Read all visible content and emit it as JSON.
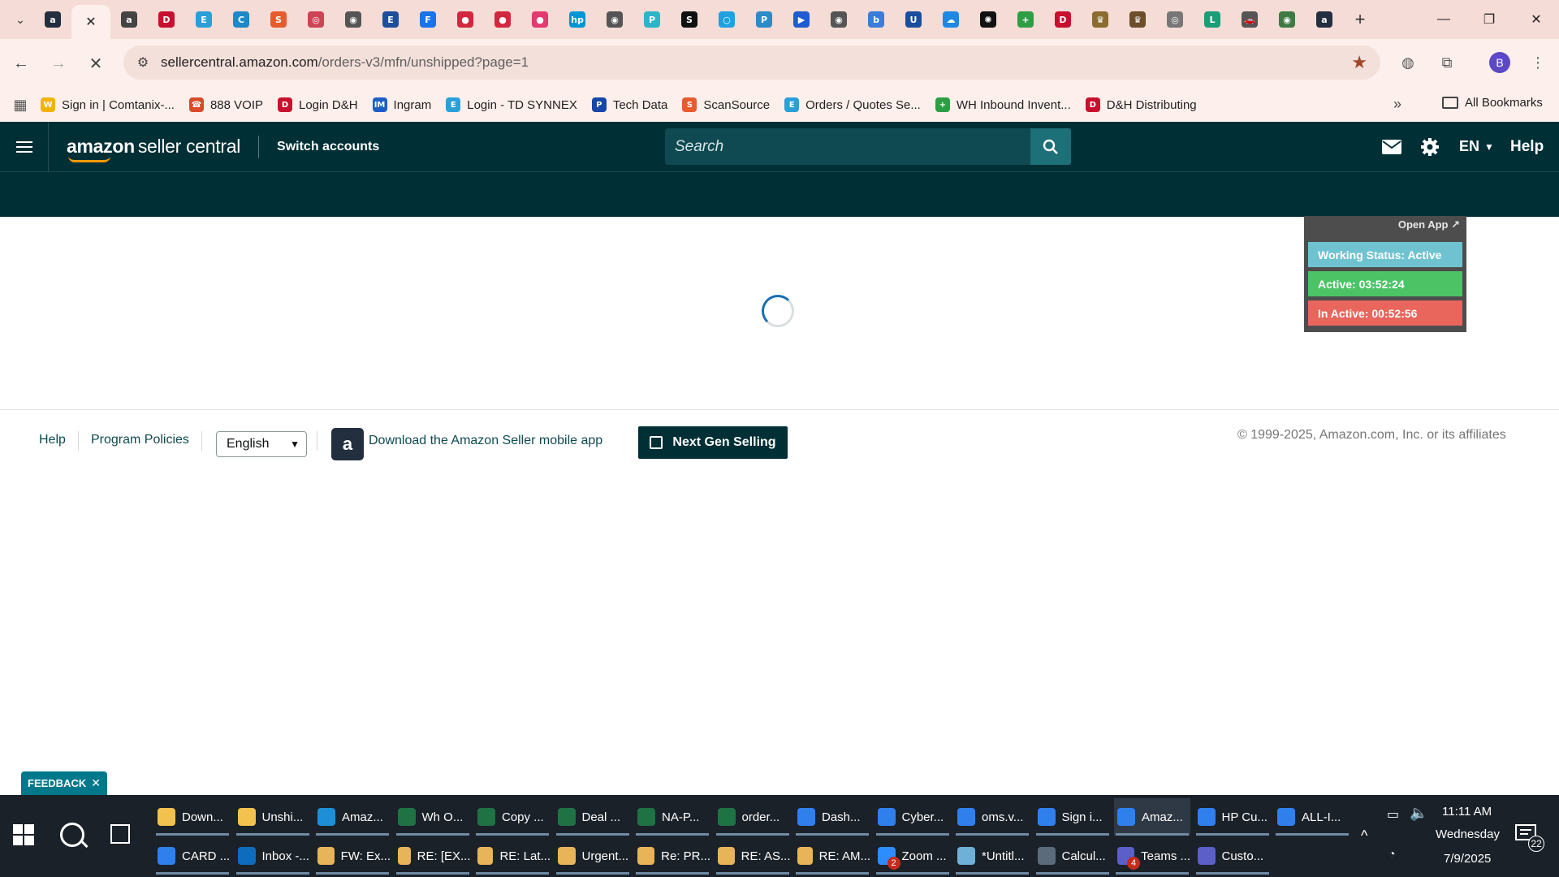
{
  "browser": {
    "tabs": [
      {
        "icon": "amazon-icon",
        "color": "#232f3e",
        "glyph": "a"
      },
      {
        "icon": "loading-tab-icon",
        "active": true
      },
      {
        "icon": "amazon-circle-icon",
        "color": "#444444",
        "glyph": "a"
      },
      {
        "icon": "dh-icon",
        "color": "#c8102e",
        "glyph": "D"
      },
      {
        "icon": "ec-icon",
        "color": "#2a9fd8",
        "glyph": "E"
      },
      {
        "icon": "bookmark-app-icon",
        "color": "#1e88c8",
        "glyph": "C"
      },
      {
        "icon": "scansource-icon",
        "color": "#e65c2e",
        "glyph": "S"
      },
      {
        "icon": "tool-icon",
        "color": "#c45",
        "glyph": "◎"
      },
      {
        "icon": "globe-icon",
        "color": "#555555",
        "glyph": "◉"
      },
      {
        "icon": "etn-icon",
        "color": "#1d4f9c",
        "glyph": "E"
      },
      {
        "icon": "f-icon",
        "color": "#1a73e8",
        "glyph": "F"
      },
      {
        "icon": "red-circle-icon",
        "color": "#d3263f",
        "glyph": "●"
      },
      {
        "icon": "red-circle-icon",
        "color": "#d3263f",
        "glyph": "●"
      },
      {
        "icon": "pink-circle-icon",
        "color": "#e23b6e",
        "glyph": "●"
      },
      {
        "icon": "hp-icon",
        "color": "#0096d6",
        "glyph": "hp"
      },
      {
        "icon": "globe-icon",
        "color": "#555555",
        "glyph": "◉"
      },
      {
        "icon": "p-icon",
        "color": "#2db4c8",
        "glyph": "P"
      },
      {
        "icon": "s-icon",
        "color": "#111111",
        "glyph": "S"
      },
      {
        "icon": "ring-icon",
        "color": "#1ea1e0",
        "glyph": "○"
      },
      {
        "icon": "p-icon",
        "color": "#2d8bc8",
        "glyph": "P"
      },
      {
        "icon": "arrow-icon",
        "color": "#1f5bd1",
        "glyph": "▶"
      },
      {
        "icon": "globe-icon",
        "color": "#555555",
        "glyph": "◉"
      },
      {
        "icon": "b-icon",
        "color": "#3b7dd8",
        "glyph": "b"
      },
      {
        "icon": "u-icon",
        "color": "#1a4fa0",
        "glyph": "U"
      },
      {
        "icon": "cloud-icon",
        "color": "#1e88e5",
        "glyph": "☁"
      },
      {
        "icon": "openai-icon",
        "color": "#111111",
        "glyph": "✺"
      },
      {
        "icon": "plus-green-icon",
        "color": "#2e9e44",
        "glyph": "+"
      },
      {
        "icon": "dh-icon",
        "color": "#c8102e",
        "glyph": "D"
      },
      {
        "icon": "crown-icon",
        "color": "#8a6d2e",
        "glyph": "♛"
      },
      {
        "icon": "crown-icon",
        "color": "#6d4d2a",
        "glyph": "♛"
      },
      {
        "icon": "target-icon",
        "color": "#777777",
        "glyph": "◎"
      },
      {
        "icon": "logi-icon",
        "color": "#1b9e77",
        "glyph": "L"
      },
      {
        "icon": "car-icon",
        "color": "#555555",
        "glyph": "🚗"
      },
      {
        "icon": "green-globe-icon",
        "color": "#3f7a45",
        "glyph": "◉"
      },
      {
        "icon": "amazon-icon",
        "color": "#232f3e",
        "glyph": "a"
      }
    ],
    "url_host": "sellercentral.amazon.com",
    "url_path": "/orders-v3/mfn/unshipped?page=1",
    "profile_initial": "B",
    "bookmarks": [
      {
        "label": "Sign in | Comtanix-...",
        "icon": "w-icon",
        "color": "#f0b400",
        "glyph": "W"
      },
      {
        "label": "888 VOIP",
        "icon": "voip-icon",
        "color": "#d94a2b",
        "glyph": "☎"
      },
      {
        "label": "Login D&H",
        "icon": "dh-icon",
        "color": "#c8102e",
        "glyph": "D"
      },
      {
        "label": "Ingram",
        "icon": "im-icon",
        "color": "#1d5fc1",
        "glyph": "IM"
      },
      {
        "label": "Login - TD SYNNEX",
        "icon": "ec-icon",
        "color": "#2a9fd8",
        "glyph": "E"
      },
      {
        "label": "Tech Data",
        "icon": "tech-data-icon",
        "color": "#1846a8",
        "glyph": "P"
      },
      {
        "label": "ScanSource",
        "icon": "scansource-icon",
        "color": "#e65c2e",
        "glyph": "S"
      },
      {
        "label": "Orders / Quotes Se...",
        "icon": "ec-icon",
        "color": "#2a9fd8",
        "glyph": "E"
      },
      {
        "label": "WH Inbound Invent...",
        "icon": "sheets-icon",
        "color": "#2e9e44",
        "glyph": "+"
      },
      {
        "label": "D&H Distributing",
        "icon": "dh-icon",
        "color": "#c8102e",
        "glyph": "D"
      }
    ],
    "all_bookmarks": "All Bookmarks"
  },
  "seller_central": {
    "logo_amazon": "amazon",
    "logo_rest": "seller central",
    "switch_accounts": "Switch accounts",
    "search_placeholder": "Search",
    "language": "EN",
    "help": "Help"
  },
  "status_widget": {
    "open_app": "Open App ↗",
    "working_status": "Working Status: Active",
    "active": "Active: 03:52:24",
    "inactive": "In Active: 00:52:56",
    "colors": {
      "working": "#6fc3d0",
      "active": "#4cc466",
      "inactive": "#e8665c"
    }
  },
  "footer": {
    "help": "Help",
    "program_policies": "Program Policies",
    "language_select": "English",
    "download_app": "Download the Amazon Seller mobile app",
    "next_gen": "Next Gen Selling",
    "copyright": "© 1999-2025, Amazon.com, Inc. or its affiliates"
  },
  "feedback": "FEEDBACK",
  "taskbar": {
    "row1": [
      {
        "label": "Down...",
        "icon": "folder-icon",
        "color": "#f2c14e"
      },
      {
        "label": "Unshi...",
        "icon": "folder-icon",
        "color": "#f2c14e"
      },
      {
        "label": "Amaz...",
        "icon": "edge-icon",
        "color": "#1d8fd6"
      },
      {
        "label": "Wh O...",
        "icon": "excel-icon",
        "color": "#1f7244"
      },
      {
        "label": "Copy ...",
        "icon": "excel-icon",
        "color": "#1f7244"
      },
      {
        "label": "Deal ...",
        "icon": "excel-icon",
        "color": "#1f7244"
      },
      {
        "label": "NA-P...",
        "icon": "excel-icon",
        "color": "#1f7244"
      },
      {
        "label": "order...",
        "icon": "excel-icon",
        "color": "#1f7244"
      },
      {
        "label": "Dash...",
        "icon": "chrome-icon",
        "color": "#2f80ed"
      },
      {
        "label": "Cyber...",
        "icon": "chrome-icon",
        "color": "#2f80ed"
      },
      {
        "label": "oms.v...",
        "icon": "chrome-icon",
        "color": "#2f80ed"
      },
      {
        "label": "Sign i...",
        "icon": "chrome-icon",
        "color": "#2f80ed"
      },
      {
        "label": "Amaz...",
        "icon": "chrome-icon",
        "color": "#2f80ed",
        "active": true
      },
      {
        "label": "HP Cu...",
        "icon": "chrome-icon",
        "color": "#2f80ed"
      },
      {
        "label": "ALL-I...",
        "icon": "chrome-icon",
        "color": "#2f80ed"
      }
    ],
    "row2": [
      {
        "label": "CARD ...",
        "icon": "chrome-icon",
        "color": "#2f80ed"
      },
      {
        "label": "Inbox -...",
        "icon": "outlook-icon",
        "color": "#0f6cbd"
      },
      {
        "label": "FW: Ex...",
        "icon": "mail-icon",
        "color": "#e8b45a"
      },
      {
        "label": "RE: [EX...",
        "icon": "mail-icon",
        "color": "#e8b45a"
      },
      {
        "label": "RE: Lat...",
        "icon": "mail-icon",
        "color": "#e8b45a"
      },
      {
        "label": "Urgent...",
        "icon": "mail-icon",
        "color": "#e8b45a"
      },
      {
        "label": "Re: PR...",
        "icon": "mail-icon",
        "color": "#e8b45a"
      },
      {
        "label": "RE: AS...",
        "icon": "mail-icon",
        "color": "#e8b45a"
      },
      {
        "label": "RE: AM...",
        "icon": "mail-icon",
        "color": "#e8b45a"
      },
      {
        "label": "Zoom ...",
        "icon": "zoom-icon",
        "color": "#2d8cff",
        "badge": "2"
      },
      {
        "label": "*Untitl...",
        "icon": "notepad-icon",
        "color": "#6fb0d8"
      },
      {
        "label": "Calcul...",
        "icon": "calculator-icon",
        "color": "#5b6b7b"
      },
      {
        "label": "Teams ...",
        "icon": "teams-icon",
        "color": "#5b5fc7",
        "badge": "4"
      },
      {
        "label": "Custo...",
        "icon": "teams-icon",
        "color": "#5b5fc7"
      }
    ],
    "time": "11:11 AM",
    "day": "Wednesday",
    "date": "7/9/2025",
    "notifications": "22"
  }
}
